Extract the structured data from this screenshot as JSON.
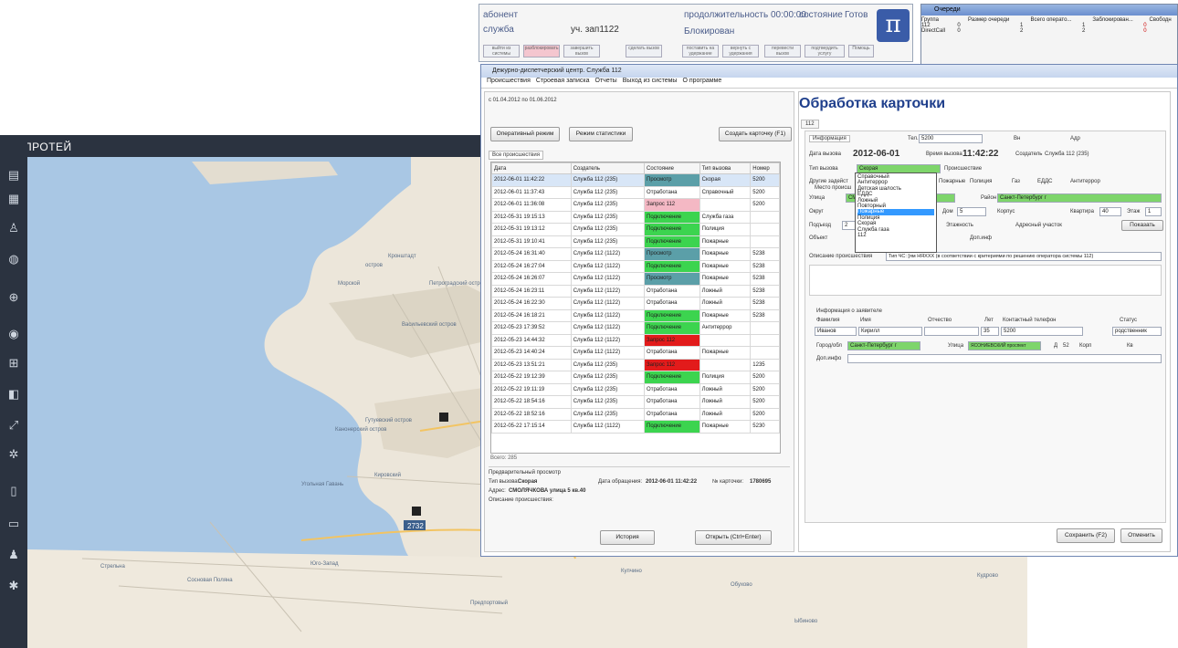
{
  "left_app": {
    "logo": "π",
    "title": "ПРОТЕЙ",
    "map_badge": "2732",
    "icons": [
      "truck-icon",
      "grid-icon",
      "person-icon",
      "globe-icon",
      "compass-icon",
      "camera-icon",
      "car-front-icon",
      "car-icon",
      "expand-icon",
      "gear-icon",
      "document-icon",
      "list-icon",
      "user-icon",
      "settings-icon"
    ]
  },
  "map": {
    "labels": [
      "Кронштадт",
      "Васильевский остров",
      "Морской",
      "остров",
      "Петроградский остров",
      "Канонерский остров",
      "Гутуевский остров",
      "Угольная Гавань",
      "Кировский",
      "Стрельна",
      "Сосновая Поляна",
      "Юго-Запад",
      "Предпортовый",
      "Купчино",
      "Обухово",
      "Кудрово",
      "Ыбиново"
    ]
  },
  "callbar": {
    "subscriber_label": "абонент",
    "service_label": "служба",
    "section": "уч. зап1122",
    "duration_label": "продолжительность 00:00:00",
    "state_label": "состояние",
    "state_value": "Готов",
    "blocked": "Блокирован",
    "buttons": [
      "выйти из системы",
      "разблокировать",
      "завершить вызов",
      "сделать вызов",
      "поставить на удержание",
      "вернуть с удержания",
      "перевести вызов",
      "подтвердить услугу",
      "Помощь"
    ]
  },
  "queues": {
    "title": "Очереди",
    "headers": [
      "Группа",
      "Размер очереди",
      "Всего операто...",
      "Заблокирован...",
      "Свободн"
    ],
    "rows": [
      [
        "112",
        "0",
        "1",
        "1",
        "0"
      ],
      [
        "DirectCall",
        "0",
        "2",
        "2",
        "0"
      ]
    ]
  },
  "main": {
    "title": "Дежурно-диспетчерский центр. Служба 112",
    "menu": [
      "Происшествия",
      "Строевая записка",
      "Отчеты",
      "Выход из системы",
      "О программе"
    ],
    "period": "с 01.04.2012 по 01.06.2012",
    "btn_operative": "Оперативный режим",
    "btn_stats": "Режим статистики",
    "btn_create": "Создать карточку (F1)",
    "tab_all": "Все происшествия",
    "table_headers": [
      "Дата",
      "Создатель",
      "Состояние",
      "Тип вызова",
      "Номер"
    ],
    "rows": [
      [
        "2012-06-01 11:42:22",
        "Служба 112 (235)",
        "Просмотр",
        "Скорая",
        "5200"
      ],
      [
        "2012-06-01 11:37:43",
        "Служба 112 (235)",
        "Отработана",
        "Справочный",
        "5200"
      ],
      [
        "2012-06-01 11:36:08",
        "Служба 112 (235)",
        "Запрос 112",
        "",
        "5200"
      ],
      [
        "2012-05-31 19:15:13",
        "Служба 112 (235)",
        "Подключение",
        "Служба газа",
        ""
      ],
      [
        "2012-05-31 19:13:12",
        "Служба 112 (235)",
        "Подключение",
        "Полиция",
        ""
      ],
      [
        "2012-05-31 19:10:41",
        "Служба 112 (235)",
        "Подключение",
        "Пожарные",
        ""
      ],
      [
        "2012-05-24 16:31:40",
        "Служба 112 (1122)",
        "Просмотр",
        "Пожарные",
        "5238"
      ],
      [
        "2012-05-24 16:27:04",
        "Служба 112 (1122)",
        "Подключение",
        "Пожарные",
        "5238"
      ],
      [
        "2012-05-24 16:26:07",
        "Служба 112 (1122)",
        "Просмотр",
        "Пожарные",
        "5238"
      ],
      [
        "2012-05-24 16:23:11",
        "Служба 112 (1122)",
        "Отработана",
        "Ложный",
        "5238"
      ],
      [
        "2012-05-24 16:22:30",
        "Служба 112 (1122)",
        "Отработана",
        "Ложный",
        "5238"
      ],
      [
        "2012-05-24 16:18:21",
        "Служба 112 (1122)",
        "Подключение",
        "Пожарные",
        "5238"
      ],
      [
        "2012-05-23 17:39:52",
        "Служба 112 (1122)",
        "Подключение",
        "Антитеррор",
        ""
      ],
      [
        "2012-05-23 14:44:32",
        "Служба 112 (1122)",
        "Запрос 112",
        "",
        ""
      ],
      [
        "2012-05-23 14:40:24",
        "Служба 112 (1122)",
        "Отработана",
        "Пожарные",
        ""
      ],
      [
        "2012-05-23 13:51:21",
        "Служба 112 (235)",
        "Запрос 112",
        "",
        "1235"
      ],
      [
        "2012-05-22 19:12:39",
        "Служба 112 (235)",
        "Подключение",
        "Полиция",
        "5200"
      ],
      [
        "2012-05-22 19:11:19",
        "Служба 112 (235)",
        "Отработана",
        "Ложный",
        "5200"
      ],
      [
        "2012-05-22 18:54:16",
        "Служба 112 (235)",
        "Отработана",
        "Ложный",
        "5200"
      ],
      [
        "2012-05-22 18:52:16",
        "Служба 112 (235)",
        "Отработана",
        "Ложный",
        "5200"
      ],
      [
        "2012-05-22 17:15:14",
        "Служба 112 (1122)",
        "Подключение",
        "Пожарные",
        "5230"
      ]
    ],
    "total": "Всего: 285",
    "preview": {
      "title": "Предварительный просмотр",
      "type_label": "Тип вызова:",
      "type_value": "Скорая",
      "date_label": "Дата обращения:",
      "date_value": "2012-06-01 11:42:22",
      "card_label": "№ карточки:",
      "card_value": "1780695",
      "addr_label": "Адрес:",
      "addr_value": "СМОЛЯЧКОВА улица 5 кв.40",
      "desc_label": "Описание происшествия:"
    },
    "btn_history": "История",
    "btn_open": "Открыть (Ctrl+Enter)"
  },
  "card": {
    "title": "Обработка карточки",
    "tab": "112",
    "info_tab": "Информация",
    "tel_label": "Тел.",
    "tel_value": "5200",
    "vn_label": "Вн",
    "adr_label": "Адр",
    "date_label": "Дата вызова",
    "date_value": "2012-06-01",
    "time_label": "Время вызова",
    "time_value": "11:42:22",
    "creator_label": "Создатель",
    "creator_value": "Служба 112 (235)",
    "type_label": "Тип вызова",
    "type_value": "Скорая",
    "incident_label": "Происшествие",
    "other_label": "Другие задейст",
    "place_label": "Место происш",
    "checks": [
      "Пожарные",
      "Полиция",
      "Газ",
      "ЕДДС",
      "Антитеррор"
    ],
    "street_label": "Улица",
    "street_value": "СМ",
    "district_label": "Район",
    "district_value": "Санкт-Петербург г",
    "okrug_label": "Округ",
    "house_label": "Дом",
    "house_value": "5",
    "korpus_label": "Корпус",
    "kv_label": "Квартира",
    "kv_value": "40",
    "floor_label": "Этаж",
    "floor_value": "1",
    "pod_label": "Подъезд",
    "pod_value": "2",
    "etazh_label": "Этажность",
    "addr_area_label": "Адресный участок",
    "show_btn": "Показать",
    "object_label": "Объект",
    "dop_label": "Доп.инф",
    "desc_label": "Описание происшествия",
    "desc_value": "Тип ЧС: [ям НЯХХХ (в соответствии с критериями по решению оператора системы 112)",
    "dropdown": [
      "Справочный",
      "Антитеррор",
      "Детская шалость",
      "ЕДДС",
      "Ложный",
      "Повторный",
      "Пожарные",
      "Полиция",
      "Скорая",
      "Служба газа",
      "112"
    ],
    "applicant_title": "Информация о заявителе",
    "app_headers": [
      "Фамилия",
      "Имя",
      "Отчество",
      "Лет",
      "Контактный телефон",
      "Статус"
    ],
    "app_values": [
      "Иванов",
      "Кирилл",
      "",
      "35",
      "5200",
      "родственник"
    ],
    "city_label": "Город/обл",
    "city_value": "Санкт-Петербург г",
    "street2_label": "Улица",
    "street2_value": "ЯСОНИЕВСКИЙ проспект",
    "d_label": "Д",
    "d_value": "52",
    "korp2_label": "Корп",
    "kv2_label": "Кв",
    "dop2_label": "Доп.инфо",
    "btn_save": "Сохранить (F2)",
    "btn_cancel": "Отменить"
  }
}
